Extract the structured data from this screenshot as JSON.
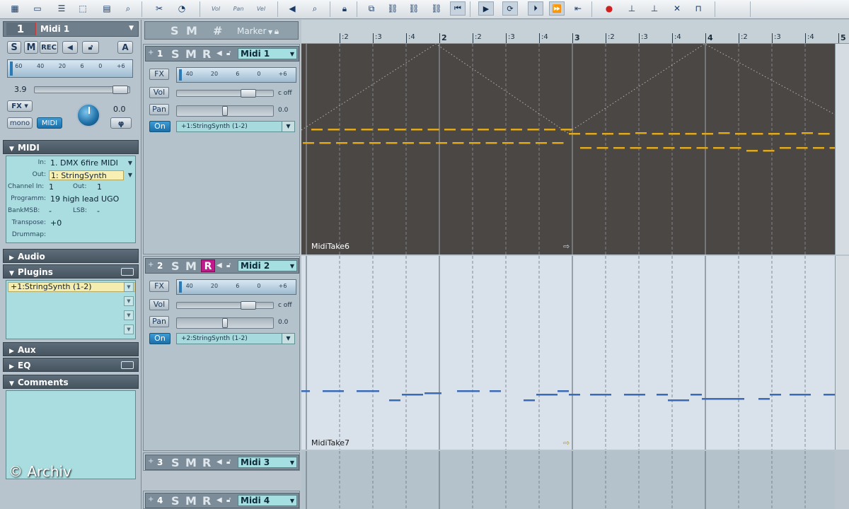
{
  "toolbar": {
    "icons": [
      "grid-icon",
      "box-icon",
      "track-icon",
      "select-icon",
      "mixer-icon",
      "zoom-icon",
      "cut-icon",
      "metronome-icon",
      "vol-icon",
      "pan-icon",
      "velocity-icon",
      "speaker-icon",
      "search-icon",
      "lock-icon",
      "link-icon",
      "chain-icon",
      "chain-icon",
      "chain-icon",
      "play-from-start-icon",
      "play-icon",
      "play-loop-icon",
      "forward-icon",
      "fast-forward-icon",
      "record-icon",
      "record-dot-icon",
      "marker-icon",
      "marker-icon",
      "marker-delete-icon",
      "punch-icon"
    ],
    "vol_label": "Vol",
    "pan_label": "Pan",
    "vel_label": "Vel"
  },
  "inspector": {
    "track_number": "1",
    "track_name": "Midi 1",
    "buttons": {
      "solo": "S",
      "mute": "M",
      "rec": "REC",
      "automation": "A"
    },
    "meter_scale": [
      "60",
      "40",
      "20",
      "6",
      "0",
      "+6"
    ],
    "volume_value": "3.9",
    "fx_label": "FX",
    "mono_label": "mono",
    "midi_btn_label": "MIDI",
    "pan_value": "0.0",
    "phase_label": "φ",
    "midi_section": {
      "title": "MIDI",
      "rows": [
        {
          "label": "In:",
          "value": "1. DMX 6fire MIDI"
        },
        {
          "label": "Out:",
          "value": "1: StringSynth"
        },
        {
          "label": "Channel In:",
          "value": "1",
          "label2": "Out:",
          "value2": "1"
        },
        {
          "label": "Programm:",
          "value": "19 high lead UGO"
        },
        {
          "label": "BankMSB:",
          "value": "-",
          "label2": "LSB:",
          "value2": "-"
        },
        {
          "label": "Transpose:",
          "value": "+0"
        },
        {
          "label": "Drummap:",
          "value": ""
        }
      ]
    },
    "audio_title": "Audio",
    "plugins_title": "Plugins",
    "plugin_slot": "+1:StringSynth (1-2)",
    "aux_title": "Aux",
    "eq_title": "EQ",
    "comments_title": "Comments"
  },
  "copyright": "© Archiv",
  "marker_bar": {
    "s": "S",
    "m": "M",
    "hash": "#",
    "label": "Marker"
  },
  "tracks": [
    {
      "number": "1",
      "name": "Midi 1",
      "fx": "FX",
      "vol": "Vol",
      "pan": "Pan",
      "on": "On",
      "vol_value": "c off",
      "pan_value": "0.0",
      "route": "+1:StringSynth (1-2)",
      "meter_scale": [
        "40",
        "20",
        "6",
        "0",
        "+6"
      ],
      "rec_active": false
    },
    {
      "number": "2",
      "name": "Midi 2",
      "fx": "FX",
      "vol": "Vol",
      "pan": "Pan",
      "on": "On",
      "vol_value": "c off",
      "pan_value": "0.0",
      "route": "+2:StringSynth (1-2)",
      "meter_scale": [
        "40",
        "20",
        "6",
        "0",
        "+6"
      ],
      "rec_active": true
    },
    {
      "number": "3",
      "name": "Midi 3"
    },
    {
      "number": "4",
      "name": "Midi 4"
    }
  ],
  "track_letters": {
    "s": "S",
    "m": "M",
    "r": "R"
  },
  "ruler": {
    "bars": [
      "2",
      "3",
      "4",
      "5"
    ],
    "beats": [
      ":2",
      ":3",
      ":4"
    ]
  },
  "clips": [
    {
      "name": "MidiTake6",
      "background": "#4b4745",
      "note_color": "#e0a81c",
      "label_color": "#ffffff"
    },
    {
      "name": "MidiTake7",
      "background": "#d9e2ea",
      "note_color": "#3c6bb5",
      "label_color": "#1a1a1a"
    }
  ]
}
